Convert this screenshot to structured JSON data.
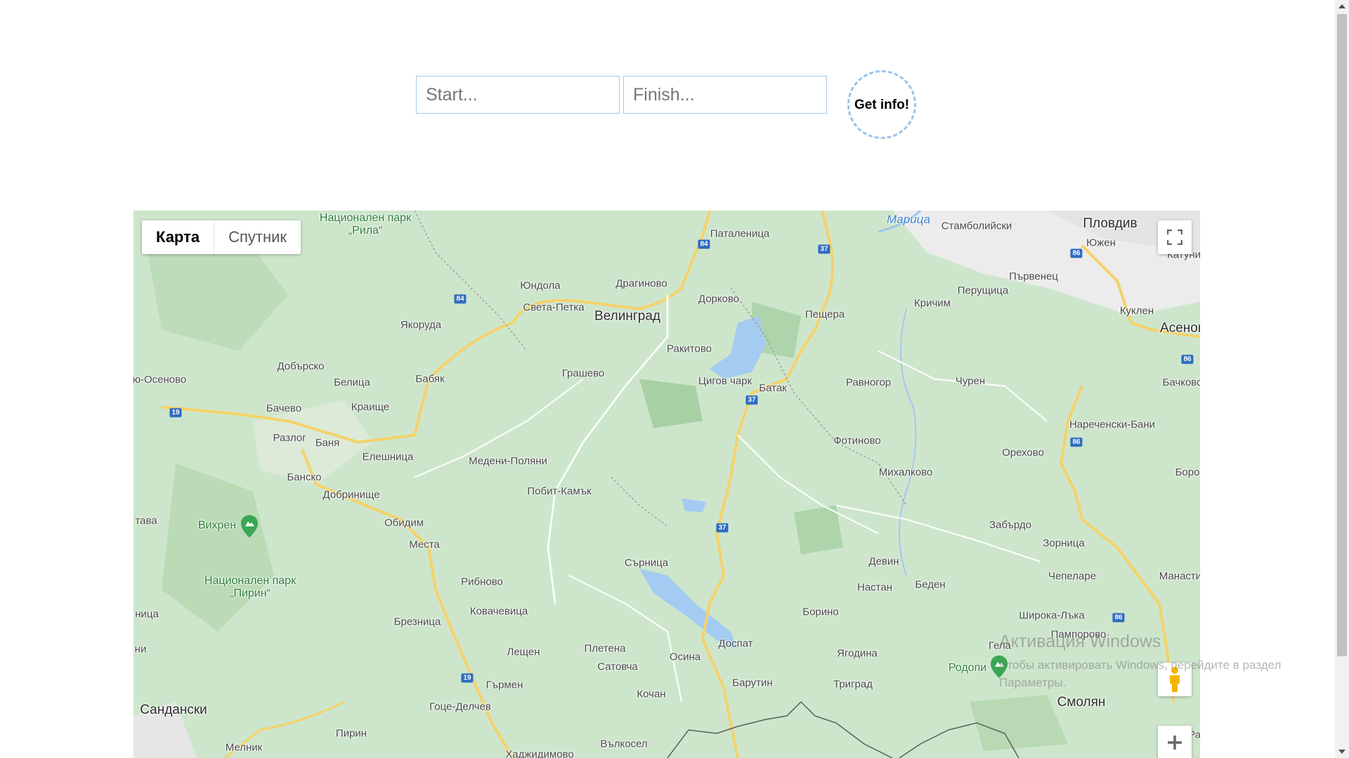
{
  "form": {
    "start_placeholder": "Start...",
    "finish_placeholder": "Finish...",
    "button_label": "Get info!"
  },
  "map": {
    "type_buttons": {
      "map": "Карта",
      "satellite": "Спутник"
    },
    "cities": {
      "velingrad": "Велинград",
      "plovdiv": "Пловдив",
      "smolyan": "Смолян",
      "sandanski": "Сандански",
      "asenov": "Асенов"
    },
    "villages": {
      "patalenitsa": "Паталеница",
      "stamboliyski": "Стамболийски",
      "yuzhen": "Южен",
      "katuni": "Катуни",
      "yundola": "Юндола",
      "draginovo": "Драгиново",
      "sveta_petka": "Света-Петка",
      "dorkovo": "Дорково",
      "peshtera": "Пещера",
      "krichim": "Кричим",
      "perushtitsa": "Перущица",
      "parvenets": "Първенец",
      "kuklen": "Куклен",
      "yakoruda": "Якоруда",
      "rakitovo": "Ракитово",
      "osenovo": "ю-Осеново",
      "dobarsko": "Добърско",
      "belitsa": "Белица",
      "babyak": "Бабяк",
      "grashevo": "Грашево",
      "tsigov_chark": "Цигов чарк",
      "batak": "Батак",
      "ravnogor": "Равногор",
      "churen": "Чурен",
      "bachkovo": "Бачково",
      "bachevo": "Бачево",
      "kraishte": "Краище",
      "razlog": "Разлог",
      "banya": "Баня",
      "fotinovo": "Фотиново",
      "narechenski_bani": "Нареченски-Бани",
      "bansko": "Банско",
      "eleshnitsa": "Елешница",
      "medeni_polyani": "Медени-Поляни",
      "orehovo": "Орехово",
      "mihalkovo": "Михалково",
      "boro": "Боро",
      "dobrinishte": "Добринище",
      "pobit_kamak": "Побит-Камък",
      "tava": "тава",
      "obidim": "Обидим",
      "zabardo": "Забърдо",
      "zornitsa": "Зорница",
      "mesta": "Места",
      "devin": "Девин",
      "sarnitsa": "Сърница",
      "chepelare": "Чепеларе",
      "manastir": "Манасти",
      "ribnovo": "Рибново",
      "nastan": "Настан",
      "beden": "Беден",
      "nitsa": "ница",
      "kovachevitsa": "Ковачевица",
      "borino": "Борино",
      "shiroka_laka": "Широка-Лъка",
      "pamporovo": "Пампорово",
      "breznitsa": "Брезница",
      "dospat": "Доспат",
      "gela": "Гела",
      "ni": "ни",
      "plethena": "Плетена",
      "leshten": "Лещен",
      "osina": "Осина",
      "yagodina": "Ягодина",
      "satovcha": "Сатовча",
      "trigrad": "Триград",
      "barutin": "Барутин",
      "garmen": "Гърмен",
      "kochan": "Кочан",
      "gotse_delchev": "Гоце-Делчев",
      "pirin": "Пирин",
      "vilkosel": "Вълкосел",
      "melnik": "Мелник",
      "hadzhidimovo": "Хаджидимово",
      "ra": "Ра"
    },
    "parks": {
      "rila": "Национален парк „Рила“",
      "pirin": "Национален парк „Пирин“",
      "vihren": "Вихрен",
      "rodopi": "Родопи"
    },
    "rivers": {
      "maritsa": "Марица"
    },
    "road_numbers": [
      "84",
      "37",
      "86",
      "19"
    ],
    "icons": {
      "fullscreen": "fullscreen-icon",
      "pegman": "pegman-icon",
      "zoom_in": "plus-icon",
      "peak": "mountain-marker-icon"
    }
  },
  "watermark": {
    "title": "Активация Windows",
    "text": "Чтобы активировать Windows, перейдите в раздел Параметры."
  }
}
